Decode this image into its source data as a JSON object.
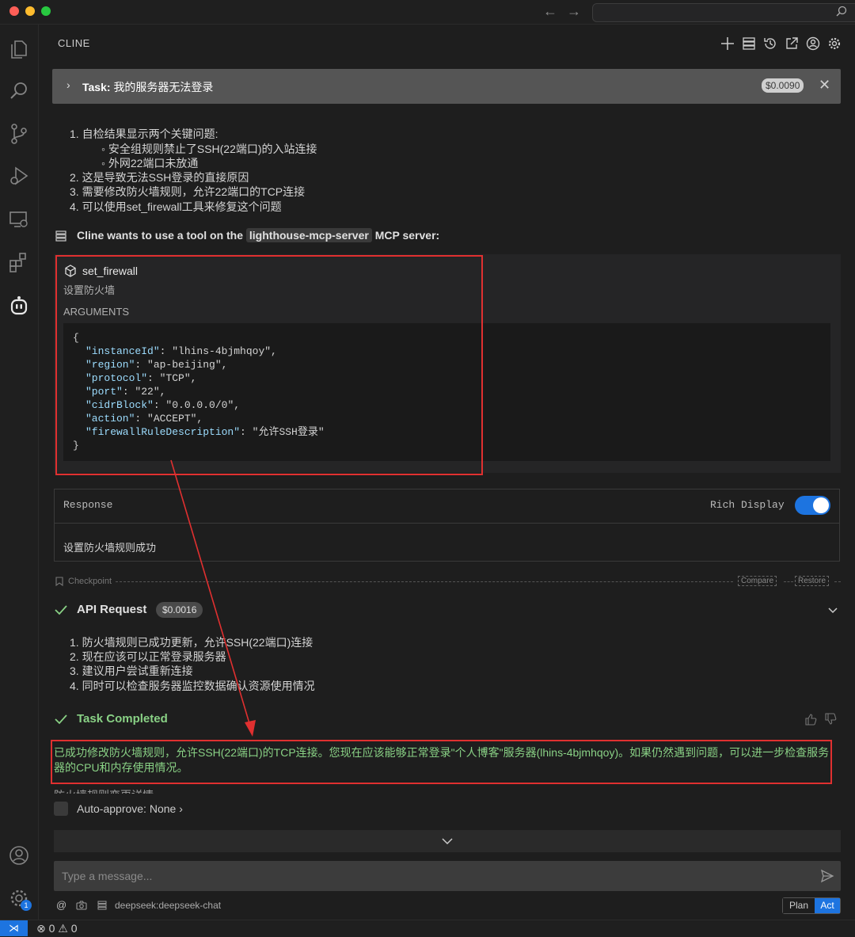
{
  "window": {
    "traffic_lights": [
      "#ff5f57",
      "#febc2e",
      "#28c840"
    ],
    "nav_back": "←",
    "nav_forward": "→"
  },
  "panel": {
    "title": "CLINE"
  },
  "task": {
    "prefix": "Task:",
    "title": "我的服务器无法登录",
    "cost": "$0.0090"
  },
  "reasoning": [
    "1. 自检结果显示两个关键问题:",
    "◦ 安全组规则禁止了SSH(22端口)的入站连接",
    "◦ 外网22端口未放通",
    "2. 这是导致无法SSH登录的直接原因",
    "3. 需要修改防火墙规则，允许22端口的TCP连接",
    "4. 可以使用set_firewall工具来修复这个问题"
  ],
  "tool_request": {
    "prefix": "Cline wants to use a tool on the",
    "server": "lighthouse-mcp-server",
    "suffix": "MCP server:",
    "tool_name": "set_firewall",
    "tool_desc": "设置防火墙",
    "args_label": "ARGUMENTS",
    "args": [
      {
        "key": "\"instanceId\"",
        "value": ": \"lhins-4bjmhqoy\","
      },
      {
        "key": "\"region\"",
        "value": ": \"ap-beijing\","
      },
      {
        "key": "\"protocol\"",
        "value": ": \"TCP\","
      },
      {
        "key": "\"port\"",
        "value": ": \"22\","
      },
      {
        "key": "\"cidrBlock\"",
        "value": ": \"0.0.0.0/0\","
      },
      {
        "key": "\"action\"",
        "value": ": \"ACCEPT\","
      },
      {
        "key": "\"firewallRuleDescription\"",
        "value": ": \"允许SSH登录\""
      }
    ],
    "open_brace": "{",
    "close_brace": "}"
  },
  "response": {
    "label": "Response",
    "rich_display_label": "Rich Display",
    "rich_display_on": true,
    "text": "设置防火墙规则成功"
  },
  "checkpoint": {
    "label": "Checkpoint",
    "compare": "Compare",
    "restore": "Restore"
  },
  "api_request": {
    "label": "API Request",
    "cost": "$0.0016",
    "lines": [
      "1. 防火墙规则已成功更新，允许SSH(22端口)连接",
      "2. 现在应该可以正常登录服务器",
      "3. 建议用户尝试重新连接",
      "4. 同时可以检查服务器监控数据确认资源使用情况"
    ]
  },
  "task_completed": {
    "label": "Task Completed",
    "text": "已成功修改防火墙规则，允许SSH(22端口)的TCP连接。您现在应该能够正常登录\"个人博客\"服务器(lhins-4bjmhqoy)。如果仍然遇到问题，可以进一步检查服务器的CPU和内存使用情况。",
    "cut_text": "防火墙规则变更详情"
  },
  "auto_approve": {
    "label": "Auto-approve: None",
    "chevron": "›"
  },
  "input": {
    "placeholder": "Type a message...",
    "model": "deepseek:deepseek-chat",
    "mode_plan": "Plan",
    "mode_act": "Act",
    "mode_selected": "Act"
  },
  "status": {
    "remote": "⋊",
    "errors": "⊗ 0 ⚠ 0",
    "settings_badge": "1"
  },
  "colors": {
    "accent": "#1d74e0",
    "success": "#89d185",
    "annotation_red": "#e03030"
  }
}
